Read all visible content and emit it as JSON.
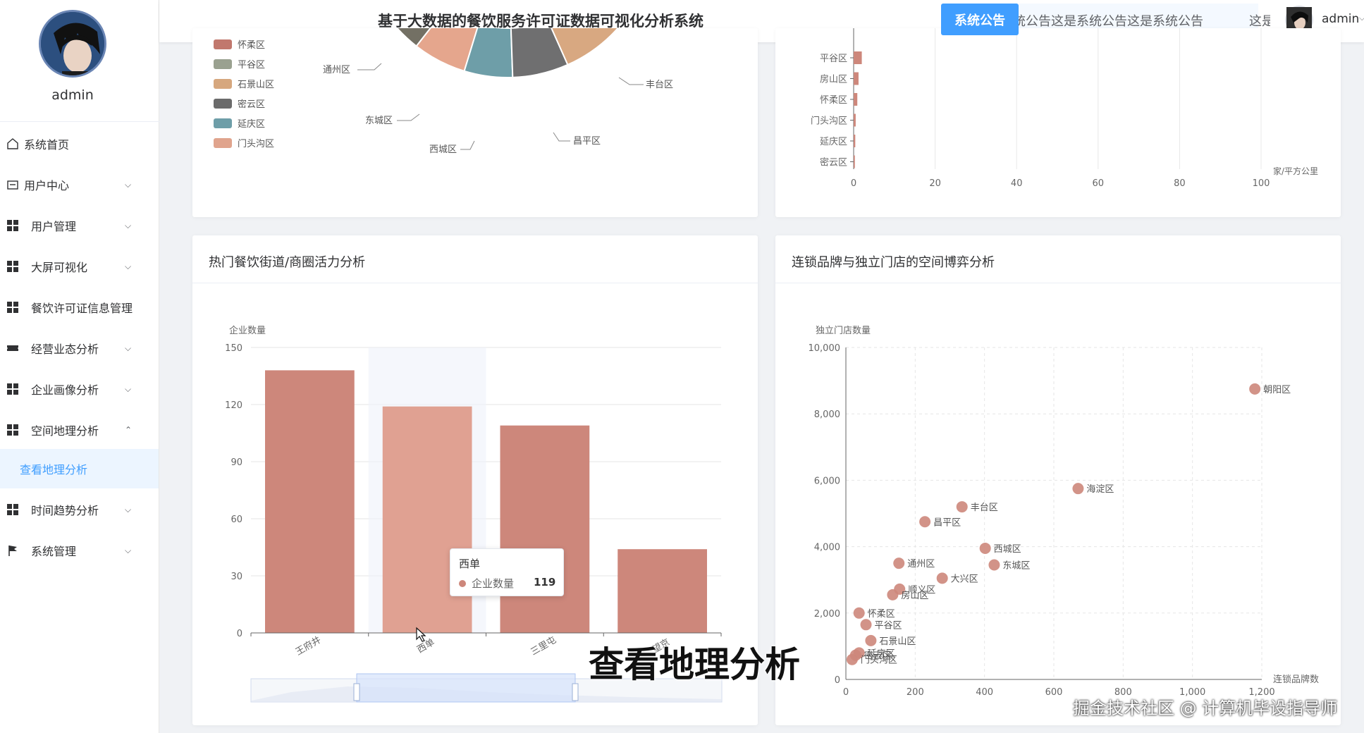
{
  "sidebar": {
    "username": "admin",
    "menu": [
      {
        "label": "系统首页",
        "icon": "home-icon",
        "arrow": ""
      },
      {
        "label": "用户中心",
        "icon": "id-card-icon",
        "arrow": "⌵"
      },
      {
        "label": "用户管理",
        "icon": "grid-icon",
        "arrow": "⌵"
      },
      {
        "label": "大屏可视化",
        "icon": "grid-icon",
        "arrow": "⌵"
      },
      {
        "label": "餐饮许可证信息管理",
        "icon": "grid-icon",
        "arrow": ""
      },
      {
        "label": "经营业态分析",
        "icon": "ticket-icon",
        "arrow": "⌵"
      },
      {
        "label": "企业画像分析",
        "icon": "grid-icon",
        "arrow": "⌵"
      },
      {
        "label": "空间地理分析",
        "icon": "grid-icon",
        "arrow": "⌃"
      },
      {
        "label": "时间趋势分析",
        "icon": "grid-icon",
        "arrow": "⌵"
      },
      {
        "label": "系统管理",
        "icon": "flag-icon",
        "arrow": "⌵"
      }
    ],
    "submenu_active": "查看地理分析"
  },
  "header": {
    "title": "基于大数据的餐饮服务许可证数据可视化分析系统",
    "notice_label": "系统公告",
    "notice_text": "统公告这是系统公告这是系统公告",
    "notice_text_tail": "这是",
    "user": "admin",
    "caret": "⌵"
  },
  "colors": {
    "accent": "#409eff",
    "bar": "#cd877b",
    "bar_highlight": "#e0a192",
    "scatter": "#cd877b"
  },
  "pie_fragment": {
    "legend": [
      {
        "label": "怀柔区",
        "color": "#c1786d"
      },
      {
        "label": "平谷区",
        "color": "#9aa190"
      },
      {
        "label": "石景山区",
        "color": "#d6a77e"
      },
      {
        "label": "密云区",
        "color": "#6b6b6b"
      },
      {
        "label": "延庆区",
        "color": "#6e9ea8"
      },
      {
        "label": "门头沟区",
        "color": "#e0a48d"
      }
    ],
    "slice_labels": [
      "通州区",
      "东城区",
      "西城区",
      "昌平区",
      "丰台区"
    ]
  },
  "density_fragment": {
    "categories": [
      "平谷区",
      "房山区",
      "怀柔区",
      "门头沟区",
      "延庆区",
      "密云区"
    ],
    "values": [
      2,
      1.2,
      0.9,
      0.5,
      0.4,
      0.3
    ],
    "x_ticks": [
      "0",
      "20",
      "40",
      "60",
      "80",
      "100"
    ],
    "x_unit": "家/平方公里"
  },
  "bar_card": {
    "title": "热门餐饮街道/商圈活力分析",
    "tooltip": {
      "title": "西单",
      "series": "企业数量",
      "value": "119"
    }
  },
  "scatter_card": {
    "title": "连锁品牌与独立门店的空间博弈分析"
  },
  "chart_data": [
    {
      "type": "bar",
      "title": "热门餐饮街道/商圈活力分析",
      "categories": [
        "王府井",
        "西单",
        "三里屯",
        "望京"
      ],
      "values": [
        138,
        119,
        109,
        44
      ],
      "ylabel": "企业数量",
      "ylim": [
        0,
        150
      ],
      "y_ticks": [
        "0",
        "30",
        "60",
        "90",
        "120",
        "150"
      ],
      "grid": true,
      "highlight_index": 1
    },
    {
      "type": "scatter",
      "title": "连锁品牌与独立门店的空间博弈分析",
      "xlabel": "连锁品牌数",
      "ylabel": "独立门店数量",
      "xlim": [
        0,
        1200
      ],
      "ylim": [
        0,
        10000
      ],
      "x_ticks": [
        "0",
        "200",
        "400",
        "600",
        "800",
        "1,000",
        "1,200"
      ],
      "y_ticks": [
        "0",
        "2,000",
        "4,000",
        "6,000",
        "8,000",
        "10,000"
      ],
      "grid": true,
      "points": [
        {
          "name": "朝阳区",
          "x": 1180,
          "y": 8750
        },
        {
          "name": "海淀区",
          "x": 670,
          "y": 5750
        },
        {
          "name": "丰台区",
          "x": 335,
          "y": 5200
        },
        {
          "name": "昌平区",
          "x": 228,
          "y": 4750
        },
        {
          "name": "西城区",
          "x": 402,
          "y": 3950
        },
        {
          "name": "通州区",
          "x": 153,
          "y": 3500
        },
        {
          "name": "东城区",
          "x": 428,
          "y": 3450
        },
        {
          "name": "大兴区",
          "x": 278,
          "y": 3050
        },
        {
          "name": "顺义区",
          "x": 155,
          "y": 2720
        },
        {
          "name": "房山区",
          "x": 135,
          "y": 2550
        },
        {
          "name": "怀柔区",
          "x": 38,
          "y": 2000
        },
        {
          "name": "平谷区",
          "x": 58,
          "y": 1650
        },
        {
          "name": "石景山区",
          "x": 72,
          "y": 1170
        },
        {
          "name": "延庆区",
          "x": 38,
          "y": 800
        },
        {
          "name": "密云区",
          "x": 28,
          "y": 730
        },
        {
          "name": "门头沟区",
          "x": 18,
          "y": 600
        }
      ]
    }
  ],
  "overlay": {
    "caption": "查看地理分析",
    "watermark": "掘金技术社区 @ 计算机毕设指导师"
  }
}
